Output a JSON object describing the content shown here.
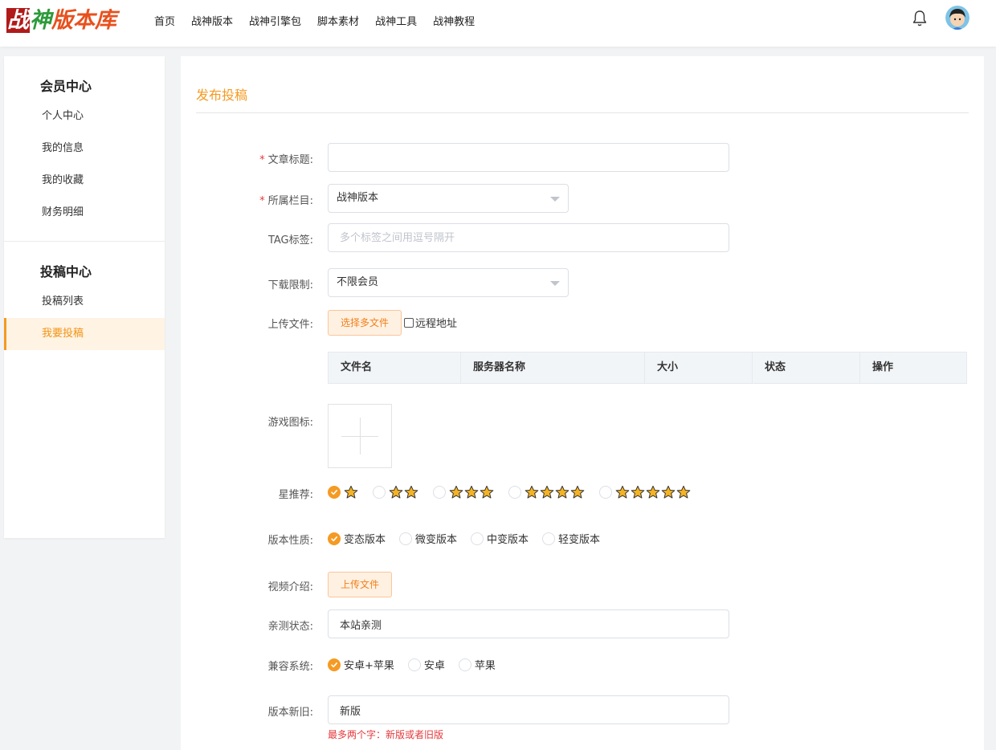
{
  "header": {
    "logo_text": "战神版本库",
    "nav": [
      "首页",
      "战神版本",
      "战神引擎包",
      "脚本素材",
      "战神工具",
      "战神教程"
    ]
  },
  "sidebar": {
    "section1_title": "会员中心",
    "section1_items": [
      "个人中心",
      "我的信息",
      "我的收藏",
      "财务明细"
    ],
    "section2_title": "投稿中心",
    "section2_items": [
      "投稿列表",
      "我要投稿"
    ],
    "active_item": "我要投稿"
  },
  "form": {
    "page_title": "发布投稿",
    "title_label": "文章标题:",
    "title_value": "",
    "category_label": "所属栏目:",
    "category_value": "战神版本",
    "tag_label": "TAG标签:",
    "tag_placeholder": "多个标签之间用逗号隔开",
    "download_label": "下载限制:",
    "download_value": "不限会员",
    "upload_label": "上传文件:",
    "upload_button": "选择多文件",
    "remote_label": "远程地址",
    "file_table_headers": [
      "文件名",
      "服务器名称",
      "大小",
      "状态",
      "操作"
    ],
    "icon_label": "游戏图标:",
    "star_label": "星推荐:",
    "star_options": [
      1,
      2,
      3,
      4,
      5
    ],
    "star_selected": 1,
    "nature_label": "版本性质:",
    "nature_options": [
      "变态版本",
      "微变版本",
      "中变版本",
      "轻变版本"
    ],
    "nature_selected": "变态版本",
    "video_label": "视频介绍:",
    "video_button": "上传文件",
    "test_label": "亲测状态:",
    "test_value": "本站亲测",
    "compat_label": "兼容系统:",
    "compat_options": [
      "安卓+苹果",
      "安卓",
      "苹果"
    ],
    "compat_selected": "安卓+苹果",
    "age_label": "版本新旧:",
    "age_value": "新版",
    "age_hint": "最多两个字：新版或者旧版"
  },
  "colors": {
    "accent": "#f59a23",
    "required": "#e4393c"
  }
}
